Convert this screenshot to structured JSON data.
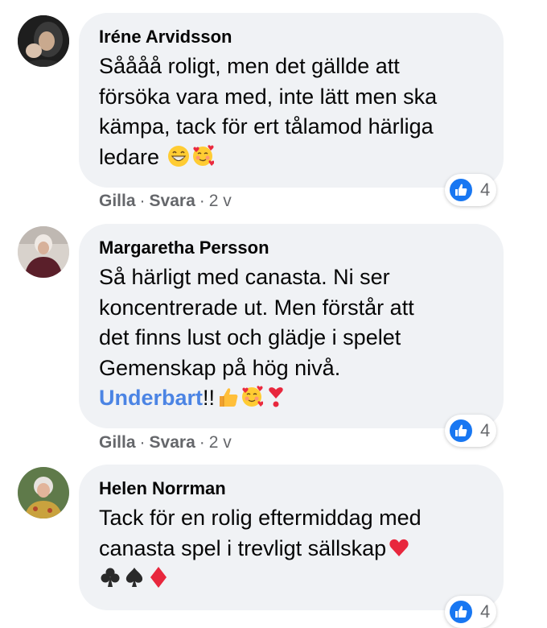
{
  "comments": [
    {
      "author": "Iréne Arvidsson",
      "lines": [
        "Såååå roligt, men det gällde att",
        "försöka vara med, inte lätt men ska",
        "kämpa, tack för ert tålamod härliga"
      ],
      "last_line_text": "ledare ",
      "emojis": [
        "grinning-face-emoji",
        "smiling-face-with-hearts-emoji"
      ],
      "like_label": "Gilla",
      "reply_label": "Svara",
      "separator": "·",
      "timestamp": "2 v",
      "reaction_count": "4"
    },
    {
      "author": "Margaretha Persson",
      "lines": [
        "Så härligt med canasta. Ni ser",
        "koncentrerade ut. Men förstår att",
        "det finns lust och glädje i spelet",
        "Gemenskap på hög nivå."
      ],
      "mention": "Underbart",
      "last_line_text": "!!",
      "emojis": [
        "thumbs-up-emoji",
        "smiling-face-with-hearts-emoji",
        "exclamation-heart-emoji"
      ],
      "like_label": "Gilla",
      "reply_label": "Svara",
      "separator": "·",
      "timestamp": "2 v",
      "reaction_count": "4"
    },
    {
      "author": "Helen Norrman",
      "lines": [
        "Tack för en rolig eftermiddag med"
      ],
      "line2_text": "canasta spel i trevligt sällskap",
      "emojis": [
        "red-heart-emoji",
        "club-suit-emoji",
        "spade-suit-emoji",
        "diamond-suit-emoji"
      ],
      "reaction_count": "4"
    }
  ],
  "colors": {
    "bubble": "#f0f2f5",
    "like_blue": "#1877f2",
    "mention": "#4b84e4",
    "meta_gray": "#65676b"
  }
}
